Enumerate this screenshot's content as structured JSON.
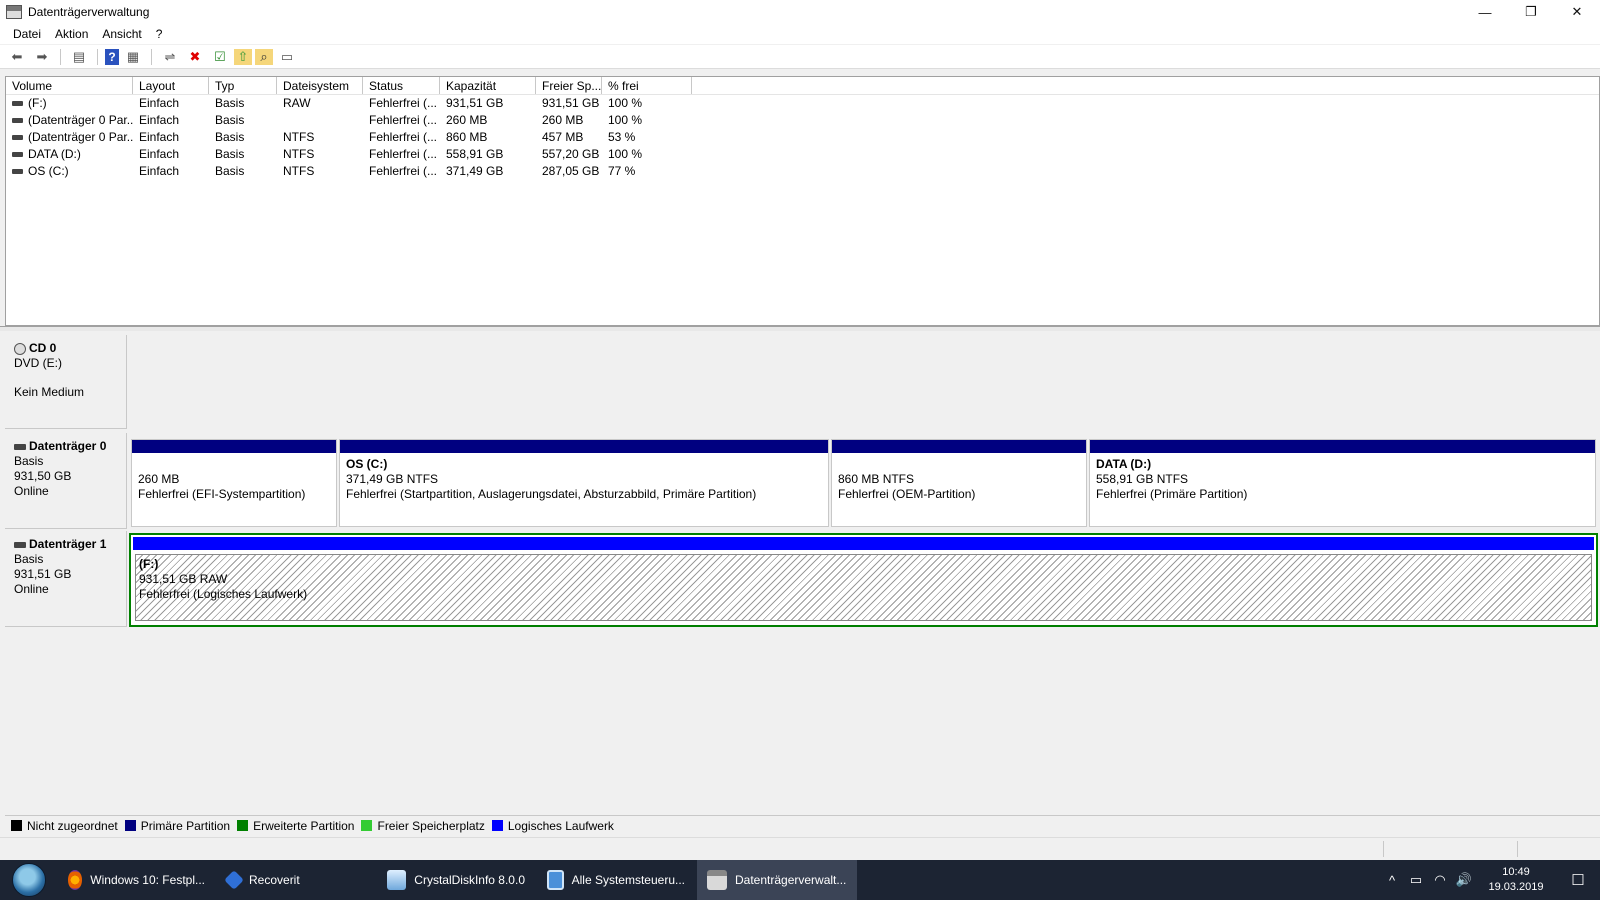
{
  "window": {
    "title": "Datenträgerverwaltung",
    "controls": {
      "minimize": "—",
      "maximize": "❐",
      "close": "✕"
    }
  },
  "menu": [
    "Datei",
    "Aktion",
    "Ansicht",
    "?"
  ],
  "toolbar": {
    "icons": [
      "back-arrow-icon",
      "forward-arrow-icon",
      "console-tree-icon",
      "help-icon",
      "properties-icon",
      "connect-icon",
      "delete-icon",
      "checkmark-icon",
      "up-folder-icon",
      "search-folder-icon",
      "settings-window-icon"
    ],
    "glyphs": {
      "back": "⬅",
      "forward": "➡",
      "tree": "▤",
      "help": "?",
      "props": "▦",
      "connect": "⇌",
      "delete": "✖",
      "check": "☑",
      "upfolder": "⇧",
      "searchfolder": "⌕",
      "settings": "▭"
    }
  },
  "volume_list": {
    "columns": [
      "Volume",
      "Layout",
      "Typ",
      "Dateisystem",
      "Status",
      "Kapazität",
      "Freier Sp...",
      "% frei"
    ],
    "rows": [
      {
        "volume": "(F:)",
        "layout": "Einfach",
        "typ": "Basis",
        "fs": "RAW",
        "status": "Fehlerfrei (...",
        "kap": "931,51 GB",
        "frei": "931,51 GB",
        "pct": "100 %"
      },
      {
        "volume": "(Datenträger 0 Par...",
        "layout": "Einfach",
        "typ": "Basis",
        "fs": "",
        "status": "Fehlerfrei (...",
        "kap": "260 MB",
        "frei": "260 MB",
        "pct": "100 %"
      },
      {
        "volume": "(Datenträger 0 Par...",
        "layout": "Einfach",
        "typ": "Basis",
        "fs": "NTFS",
        "status": "Fehlerfrei (...",
        "kap": "860 MB",
        "frei": "457 MB",
        "pct": "53 %"
      },
      {
        "volume": "DATA (D:)",
        "layout": "Einfach",
        "typ": "Basis",
        "fs": "NTFS",
        "status": "Fehlerfrei (...",
        "kap": "558,91 GB",
        "frei": "557,20 GB",
        "pct": "100 %"
      },
      {
        "volume": "OS (C:)",
        "layout": "Einfach",
        "typ": "Basis",
        "fs": "NTFS",
        "status": "Fehlerfrei (...",
        "kap": "371,49 GB",
        "frei": "287,05 GB",
        "pct": "77 %"
      }
    ]
  },
  "disks": {
    "cd0": {
      "name": "CD 0",
      "line1": "DVD (E:)",
      "line2": "Kein Medium"
    },
    "disk0": {
      "name": "Datenträger 0",
      "type": "Basis",
      "size": "931,50 GB",
      "state": "Online",
      "partitions": [
        {
          "name": "",
          "size": "260 MB",
          "status": "Fehlerfrei (EFI-Systempartition)"
        },
        {
          "name": "OS  (C:)",
          "size": "371,49 GB NTFS",
          "status": "Fehlerfrei (Startpartition, Auslagerungsdatei, Absturzabbild, Primäre Partition)"
        },
        {
          "name": "",
          "size": "860 MB NTFS",
          "status": "Fehlerfrei (OEM-Partition)"
        },
        {
          "name": "DATA  (D:)",
          "size": "558,91 GB NTFS",
          "status": "Fehlerfrei (Primäre Partition)"
        }
      ]
    },
    "disk1": {
      "name": "Datenträger 1",
      "type": "Basis",
      "size": "931,51 GB",
      "state": "Online",
      "partition": {
        "name": "(F:)",
        "size": "931,51 GB RAW",
        "status": "Fehlerfrei (Logisches Laufwerk)"
      }
    }
  },
  "legend": [
    {
      "label": "Nicht zugeordnet",
      "color": "#000000"
    },
    {
      "label": "Primäre Partition",
      "color": "#000080"
    },
    {
      "label": "Erweiterte Partition",
      "color": "#008000"
    },
    {
      "label": "Freier Speicherplatz",
      "color": "#33cc33"
    },
    {
      "label": "Logisches Laufwerk",
      "color": "#0000ff"
    }
  ],
  "taskbar": {
    "tasks": [
      {
        "label": "Windows 10: Festpl...",
        "icon": "firefox-icon",
        "color": "#e66000"
      },
      {
        "label": "Recoverit",
        "icon": "recoverit-icon",
        "color": "#2f6fd6"
      },
      {
        "label": "CrystalDiskInfo 8.0.0",
        "icon": "crystaldiskinfo-icon",
        "color": "#6fa8dc"
      },
      {
        "label": "Alle Systemsteueru...",
        "icon": "control-panel-icon",
        "color": "#4a90d9"
      },
      {
        "label": "Datenträgerverwalt...",
        "icon": "disk-management-icon",
        "color": "#bfbfbf"
      }
    ],
    "tray": {
      "chevron": "^",
      "battery": "▭",
      "wifi": "◠",
      "volume": "🔊",
      "notify": "☐"
    },
    "time": "10:49",
    "date": "19.03.2019"
  }
}
